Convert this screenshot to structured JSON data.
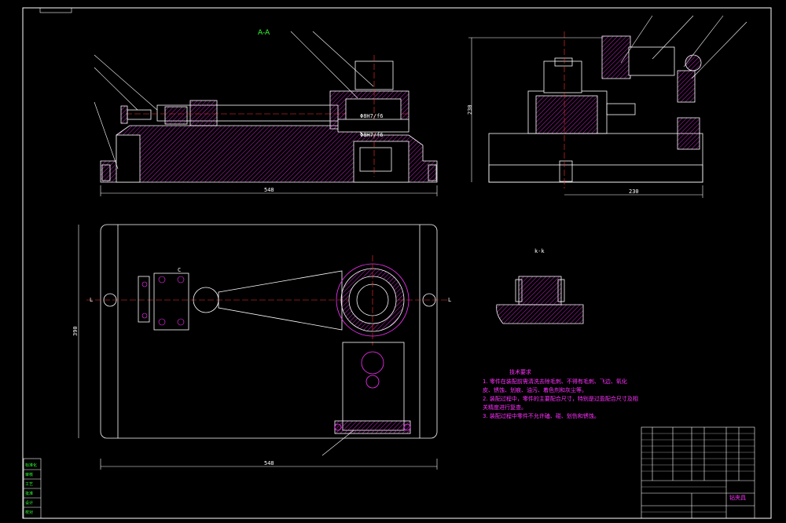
{
  "drawing": {
    "top_view": {
      "overall_dim": "548",
      "dim_text_1": "Φ8H7/f6",
      "dim_text_2": "Φ8H7/f6"
    },
    "side_view": {
      "height_dim": "230",
      "width_dim": "230"
    },
    "plan_view": {
      "overall_dim": "548",
      "height_dim": "390",
      "section_mark_left": "L",
      "section_mark_right": "L",
      "c_mark": "C"
    },
    "section_label": "k-k",
    "tech_requirements": {
      "title": "技术要求",
      "lines": [
        "1. 零件在装配前需清洗去除毛刺、不得有毛刺、飞边、氧化",
        "皮、锈蚀、划痕、油污、着色剂和灰尘等。",
        "2. 装配过程中，零件的主要配合尺寸，特别是过盈配合尺寸及相",
        "关精度进行复查。",
        "3. 装配过程中零件不允许磕、碰、划伤和锈蚀。"
      ]
    },
    "title_block": {
      "drawing_name": "钻夹具",
      "left_stamp_lines": [
        "标准化",
        "审核",
        "工艺",
        "批准",
        "设计",
        "校对"
      ]
    }
  }
}
